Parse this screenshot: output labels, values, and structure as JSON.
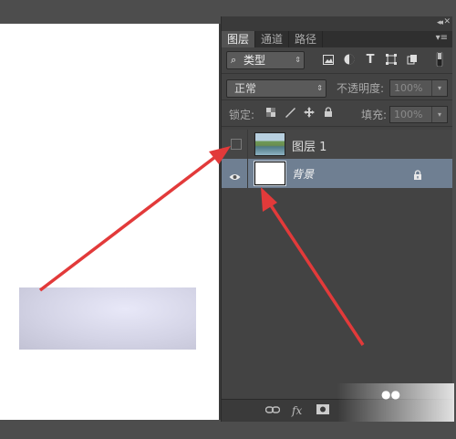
{
  "panel": {
    "tabs": [
      {
        "label": "图层",
        "active": true
      },
      {
        "label": "通道",
        "active": false
      },
      {
        "label": "路径",
        "active": false
      }
    ],
    "filter_label": "类型",
    "blend_mode": "正常",
    "opacity_label": "不透明度:",
    "opacity_value": "100%",
    "lock_label": "锁定:",
    "fill_label": "填充:",
    "fill_value": "100%",
    "layers": [
      {
        "name": "图层 1",
        "visible": false,
        "thumbnail": "photo",
        "locked": false,
        "selected": false
      },
      {
        "name": "背景",
        "visible": true,
        "thumbnail": "white",
        "locked": true,
        "selected": true
      }
    ],
    "bottom_icons": [
      "link-icon",
      "fx-icon",
      "mask-icon"
    ]
  },
  "colors": {
    "panel_bg": "#434343",
    "selected_layer": "#6f7f92",
    "arrow": "#e23a3a"
  },
  "canvas": {
    "background": "#ffffff",
    "shape": "gradient-rectangle"
  }
}
